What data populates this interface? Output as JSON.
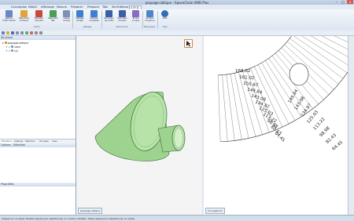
{
  "window": {
    "title": "psquage-oblique - SpaceClaim SMD Plus"
  },
  "menu": [
    "Conception",
    "Détail",
    "Affichage",
    "Mesure",
    "Préparer",
    "Préparer",
    "Tôle",
    "SimTrdBend",
    "S.M.D."
  ],
  "ribbon": {
    "buttons": [
      {
        "label": "Options\nProfil T-bride",
        "icon_color": "#6a86c9"
      },
      {
        "label": "Sélections\nsurfaces",
        "icon_color": "#e2a23c"
      },
      {
        "label": "Exporter\nCylindre",
        "icon_color": "#c94a3a"
      },
      {
        "label": "Repoudre\nBlé",
        "icon_color": "#4b9e56"
      },
      {
        "label": "Cassé\ncharpe",
        "icon_color": "#7f8fb5"
      },
      {
        "label": "Déblige\nsimple",
        "icon_color": "#3f7fd0"
      },
      {
        "label": "Déblige\ncomplexe",
        "icon_color": "#3f7fd0"
      },
      {
        "label": "Découper\nqui évite",
        "icon_color": "#3a5ea8"
      },
      {
        "label": "Découper\nmanuel",
        "icon_color": "#3a5ea8"
      },
      {
        "label": "Ecrire\ncroquis",
        "icon_color": "#8a6bc2"
      },
      {
        "label": "Surface\nmoyenne",
        "icon_color": "#4d86c7"
      },
      {
        "label": "Aide",
        "icon_color": "#2f6fb8"
      }
    ],
    "groups": [
      "S.M.D.",
      "Déblage",
      "Multi-bends",
      "Moliquitant",
      "Help"
    ]
  },
  "structure": {
    "title": "Structure",
    "root": "psquage-oblique",
    "items": [
      "cone",
      "cyl"
    ]
  },
  "panel_tabs": [
    "Structure",
    "Calques",
    "Sélection",
    "Groupes",
    "Vues"
  ],
  "options_title": "Options - Sélection",
  "properties_title": "Propriétés",
  "view_tabs": [
    "psquage-oblique",
    "Conception1"
  ],
  "status_text": "Cliquez sur un objet. Double-cliquez pour sélectionner un contour d'arêtes. Triple-cliquez pour sélectionner un solide.",
  "drawing": {
    "cut_labels": [
      "168.02",
      "161.02",
      "155.67",
      "149.84",
      "143.08",
      "134.87",
      "125.03",
      "113.22",
      "98.98",
      "82.43",
      "64.45"
    ],
    "shape_color": "#9ed28f"
  }
}
